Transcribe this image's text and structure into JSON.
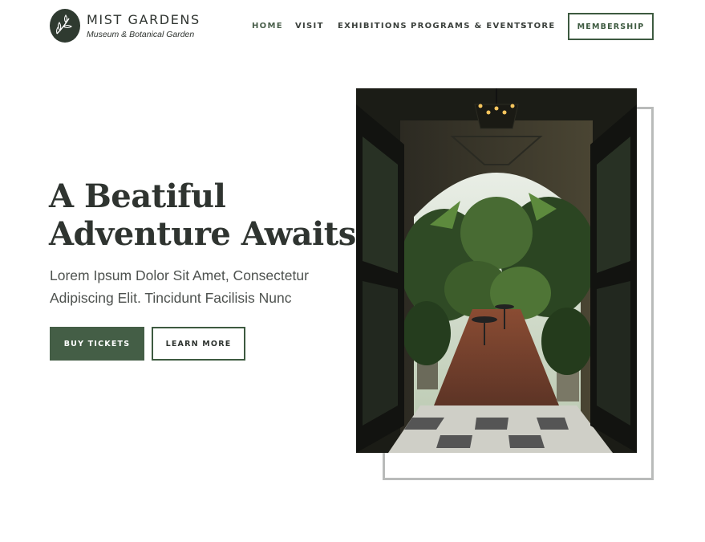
{
  "brand": {
    "name": "MIST GARDENS",
    "tagline": "Museum & Botanical Garden",
    "logo_icon": "leaf-sprig-icon"
  },
  "nav": {
    "items": [
      {
        "label": "HOME",
        "active": true
      },
      {
        "label": "VISIT",
        "active": false
      },
      {
        "label": "EXHIBITIONS",
        "active": false
      },
      {
        "label": "PROGRAMS & EVENTS",
        "active": false
      },
      {
        "label": "STORE",
        "active": false
      }
    ],
    "membership_label": "MEMBERSHIP"
  },
  "hero": {
    "title_line1": "A Beatiful",
    "title_line2": "Adventure Awaits",
    "subtitle_line1": "Lorem Ipsum Dolor Sit Amet, Consectetur",
    "subtitle_line2": "Adipiscing Elit. Tincidunt Facilisis Nunc",
    "primary_cta": "BUY TICKETS",
    "secondary_cta": "LEARN MORE"
  },
  "colors": {
    "accent": "#445e46",
    "accent_border": "#3d5a40",
    "text": "#2f3430",
    "frame": "#b9bbba"
  }
}
